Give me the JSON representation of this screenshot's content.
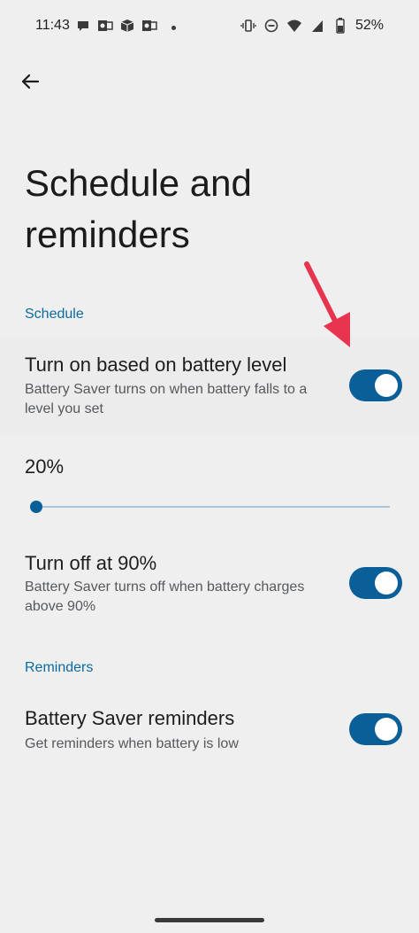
{
  "status_bar": {
    "time": "11:43",
    "battery_percent": "52%"
  },
  "page": {
    "title": "Schedule and\nreminders"
  },
  "sections": {
    "schedule": {
      "header": "Schedule",
      "battery_level_row": {
        "title": "Turn on based on battery level",
        "summary": "Battery Saver turns on when battery falls to a level you set",
        "toggle_on": true
      },
      "slider": {
        "value_label": "20%",
        "value": 0.0
      },
      "turn_off_row": {
        "title": "Turn off at 90%",
        "summary": "Battery Saver turns off when battery charges above 90%",
        "toggle_on": true
      }
    },
    "reminders": {
      "header": "Reminders",
      "reminders_row": {
        "title": "Battery Saver reminders",
        "summary": "Get reminders when battery is low",
        "toggle_on": true
      }
    }
  },
  "colors": {
    "accent": "#0a5f99",
    "section_header": "#0a6aa0",
    "annotation_arrow": "#e8354f",
    "background": "#efefef"
  },
  "icons": {
    "status_left": [
      "chat-bubble-icon",
      "outlook-icon",
      "box-icon",
      "outlook-icon"
    ],
    "status_right": [
      "vibrate-icon",
      "do-not-disturb-icon",
      "wifi-icon",
      "signal-icon",
      "battery-icon"
    ],
    "back": "arrow-back-icon"
  }
}
